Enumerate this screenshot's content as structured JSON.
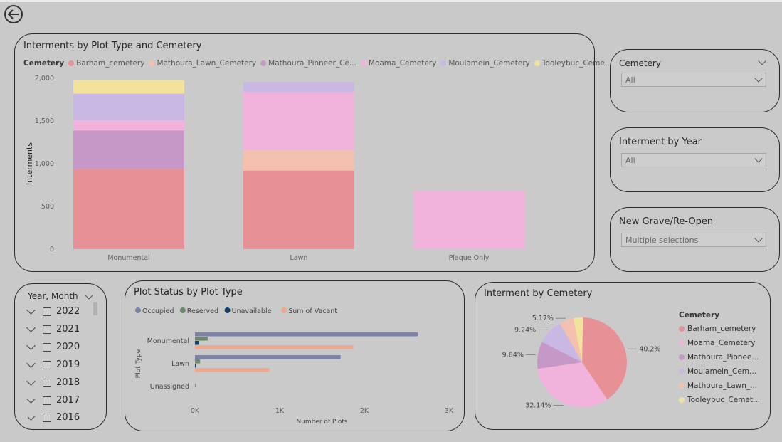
{
  "back_button_icon": "back-arrow-icon",
  "main_chart": {
    "title": "Interments by Plot Type and Cemetery",
    "legend_title": "Cemetery",
    "legend_items": [
      {
        "label": "Barham_cemetery",
        "color": "#e79197"
      },
      {
        "label": "Mathoura_Lawn_Cemetery",
        "color": "#f3c1ad"
      },
      {
        "label": "Mathoura_Pioneer_Ce...",
        "color": "#c598c7"
      },
      {
        "label": "Moama_Cemetery",
        "color": "#f1b2db"
      },
      {
        "label": "Moulamein_Cemetery",
        "color": "#c9b8e4"
      },
      {
        "label": "Tooleybuc_Ceme...",
        "color": "#f2e29b"
      }
    ]
  },
  "chart_data": [
    {
      "type": "bar",
      "stacked": true,
      "title": "Interments by Plot Type and Cemetery",
      "ylabel": "Interments",
      "xlabel": "",
      "categories": [
        "Monumental",
        "Lawn",
        "Plaque Only"
      ],
      "ylim": [
        0,
        2000
      ],
      "yticks": [
        "2,000",
        "1,500",
        "1,000",
        "500",
        "0"
      ],
      "ytick_values": [
        2000,
        1500,
        1000,
        500,
        0
      ],
      "series": [
        {
          "name": "Barham_cemetery",
          "color": "#e79197",
          "values": [
            940,
            920,
            0
          ]
        },
        {
          "name": "Mathoura_Lawn_Cemetery",
          "color": "#f3c1ad",
          "values": [
            0,
            240,
            0
          ]
        },
        {
          "name": "Mathoura_Pioneer_Ce...",
          "color": "#c598c7",
          "values": [
            450,
            0,
            0
          ]
        },
        {
          "name": "Moama_Cemetery",
          "color": "#f1b2db",
          "values": [
            120,
            680,
            680
          ]
        },
        {
          "name": "Moulamein_Cemetery",
          "color": "#c9b8e4",
          "values": [
            310,
            120,
            0
          ]
        },
        {
          "name": "Tooleybuc_Ceme...",
          "color": "#f2e29b",
          "values": [
            160,
            0,
            0
          ]
        }
      ]
    },
    {
      "type": "bar",
      "orientation": "horizontal",
      "title": "Plot Status by Plot Type",
      "ylabel": "Plot Type",
      "xlabel": "Number of Plots",
      "categories": [
        "Monumental",
        "Lawn",
        "Unassigned"
      ],
      "xlim": [
        0,
        3000
      ],
      "xticks": [
        "0K",
        "1K",
        "2K",
        "3K"
      ],
      "xtick_values": [
        0,
        1000,
        2000,
        3000
      ],
      "series": [
        {
          "name": "Occupied",
          "color": "#7c83aa",
          "values": [
            2630,
            1720,
            0
          ]
        },
        {
          "name": "Reserved",
          "color": "#6b8a6b",
          "values": [
            150,
            60,
            0
          ]
        },
        {
          "name": "Unavailable",
          "color": "#123f6b",
          "values": [
            50,
            10,
            0
          ]
        },
        {
          "name": "Sum of Vacant",
          "color": "#eda98e",
          "values": [
            1870,
            880,
            0
          ]
        }
      ]
    },
    {
      "type": "pie",
      "title": "Interment by Cemetery",
      "legend_title": "Cemetery",
      "slices": [
        {
          "name": "Barham_cemetery",
          "value": 40.2,
          "label": "40.2%",
          "color": "#e79197"
        },
        {
          "name": "Moama_Cemetery",
          "value": 32.14,
          "label": "32.14%",
          "color": "#f1b2db"
        },
        {
          "name": "Mathoura_Pionee...",
          "value": 9.84,
          "label": "9.84%",
          "color": "#c598c7"
        },
        {
          "name": "Moulamein_Cem...",
          "value": 9.24,
          "label": "9.24%",
          "color": "#c9b8e4"
        },
        {
          "name": "Mathoura_Lawn_...",
          "value": 5.17,
          "label": "5.17%",
          "color": "#f3c1ad"
        },
        {
          "name": "Tooleybuc_Cemet...",
          "value": 3.41,
          "label": "",
          "color": "#f2e29b"
        }
      ]
    }
  ],
  "slicers": {
    "cemetery": {
      "title": "Cemetery",
      "value": "All"
    },
    "interment_year": {
      "title": "Interment by Year",
      "value": "All"
    },
    "grave_reopen": {
      "title": "New Grave/Re-Open",
      "value": "Multiple selections"
    }
  },
  "year_slicer": {
    "title": "Year, Month",
    "years": [
      "2022",
      "2021",
      "2020",
      "2019",
      "2018",
      "2017",
      "2016"
    ]
  },
  "status_chart": {
    "title": "Plot Status by Plot Type"
  },
  "pie_chart": {
    "title": "Interment by Cemetery"
  }
}
